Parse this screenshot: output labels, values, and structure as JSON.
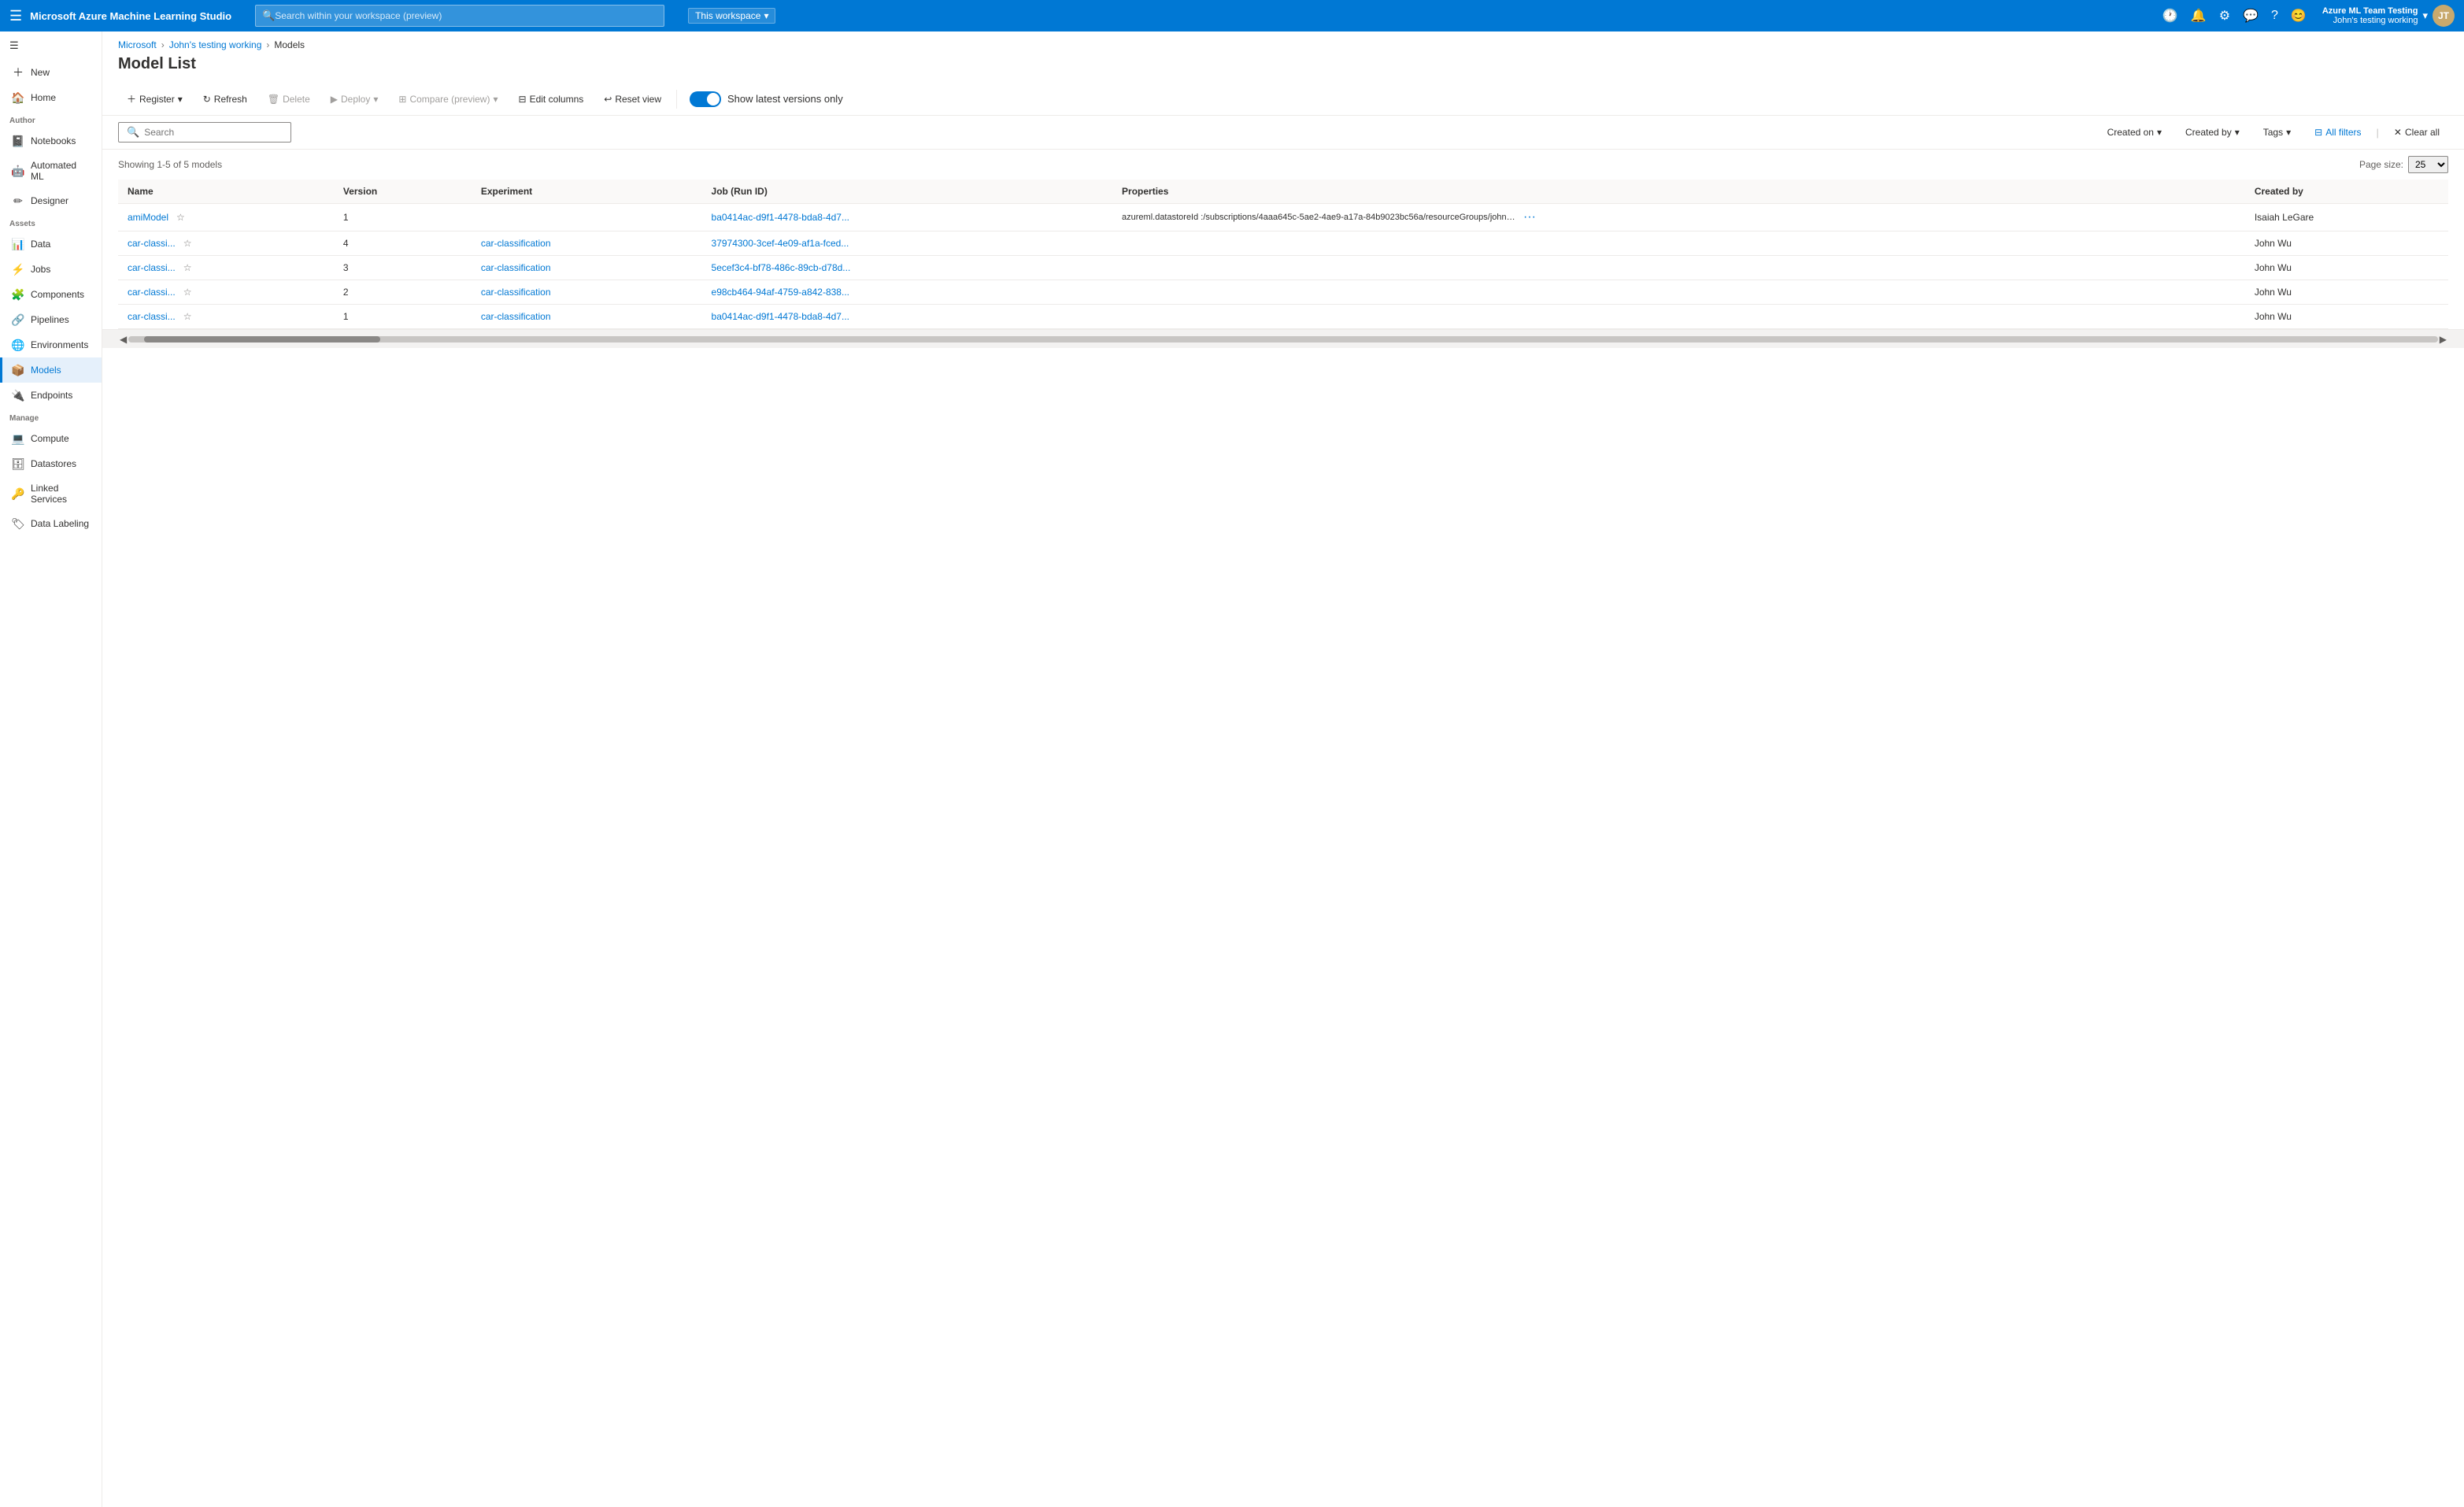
{
  "app": {
    "title": "Microsoft Azure Machine Learning Studio"
  },
  "topbar": {
    "search_placeholder": "Search within your workspace (preview)",
    "workspace_label": "This workspace",
    "user_name": "Azure ML Team Testing",
    "user_workspace": "John's testing working",
    "user_initials": "JT"
  },
  "breadcrumb": {
    "items": [
      "Microsoft",
      "John's testing working",
      "Models"
    ]
  },
  "page": {
    "title": "Model List"
  },
  "toolbar": {
    "register_label": "Register",
    "refresh_label": "Refresh",
    "delete_label": "Delete",
    "deploy_label": "Deploy",
    "compare_label": "Compare (preview)",
    "edit_columns_label": "Edit columns",
    "reset_view_label": "Reset view",
    "show_latest_label": "Show latest versions only"
  },
  "filters": {
    "search_placeholder": "Search",
    "created_on_label": "Created on",
    "created_by_label": "Created by",
    "tags_label": "Tags",
    "all_filters_label": "All filters",
    "clear_all_label": "Clear all"
  },
  "table": {
    "showing_text": "Showing 1-5 of 5 models",
    "page_size_label": "Page size:",
    "page_size_value": "25",
    "columns": [
      "Name",
      "Version",
      "Experiment",
      "Job (Run ID)",
      "Properties",
      "Created by"
    ],
    "rows": [
      {
        "name": "amiModel",
        "version": "1",
        "experiment": "",
        "job_run_id": "ba0414ac-d9f1-4478-bda8-4d7...",
        "properties": "azureml.datastoreId :/subscriptions/4aaa645c-5ae2-4ae9-a17a-84b9023bc56a/resourceGroups/john/provi...",
        "created_by": "Isaiah LeGare",
        "has_more": true
      },
      {
        "name": "car-classi...",
        "version": "4",
        "experiment": "car-classification",
        "job_run_id": "37974300-3cef-4e09-af1a-fced...",
        "properties": "",
        "created_by": "John Wu",
        "has_more": false
      },
      {
        "name": "car-classi...",
        "version": "3",
        "experiment": "car-classification",
        "job_run_id": "5ecef3c4-bf78-486c-89cb-d78d...",
        "properties": "",
        "created_by": "John Wu",
        "has_more": false
      },
      {
        "name": "car-classi...",
        "version": "2",
        "experiment": "car-classification",
        "job_run_id": "e98cb464-94af-4759-a842-838...",
        "properties": "",
        "created_by": "John Wu",
        "has_more": false
      },
      {
        "name": "car-classi...",
        "version": "1",
        "experiment": "car-classification",
        "job_run_id": "ba0414ac-d9f1-4478-bda8-4d7...",
        "properties": "",
        "created_by": "John Wu",
        "has_more": false
      }
    ]
  },
  "sidebar": {
    "new_label": "New",
    "home_label": "Home",
    "author_label": "Author",
    "notebooks_label": "Notebooks",
    "automated_ml_label": "Automated ML",
    "designer_label": "Designer",
    "assets_label": "Assets",
    "data_label": "Data",
    "jobs_label": "Jobs",
    "components_label": "Components",
    "pipelines_label": "Pipelines",
    "environments_label": "Environments",
    "models_label": "Models",
    "endpoints_label": "Endpoints",
    "manage_label": "Manage",
    "compute_label": "Compute",
    "datastores_label": "Datastores",
    "linked_services_label": "Linked Services",
    "data_labeling_label": "Data Labeling"
  }
}
